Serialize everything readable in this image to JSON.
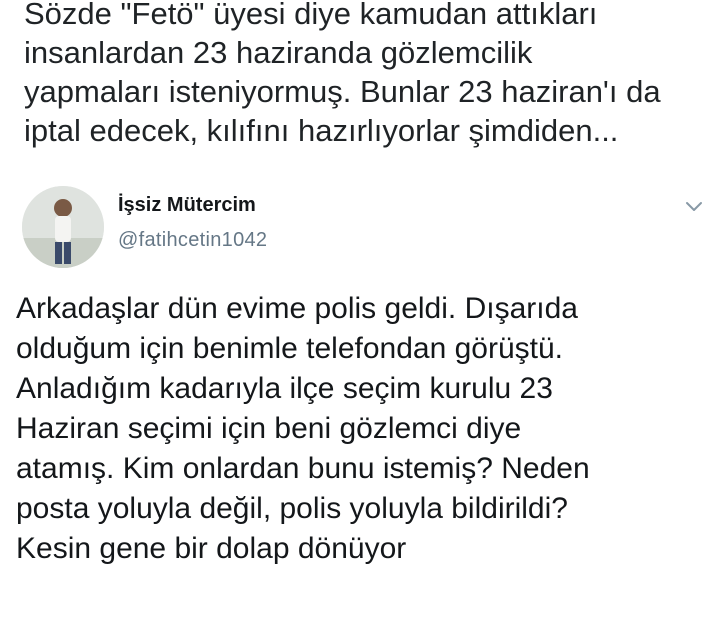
{
  "quote": {
    "text": "Sözde \"Fetö\" üyesi diye kamudan attıkları\ninsanlardan 23 haziranda gözlemcilik\nyapmaları isteniyormuş. Bunlar 23 haziran'ı da\niptal edecek, kılıfını hazırlıyorlar şimdiden..."
  },
  "tweet": {
    "author_name": "İşsiz Mütercim",
    "author_handle": "@fatihcetin1042",
    "menu_icon": "chevron-down-icon",
    "avatar_icon": "profile-photo",
    "text": "Arkadaşlar dün evime polis geldi. Dışarıda\nolduğum için benimle telefondan görüştü.\nAnladığım kadarıyla ilçe seçim kurulu 23\nHaziran seçimi için beni gözlemci diye\natamış. Kim onlardan bunu istemiş? Neden\nposta yoluyla değil, polis yoluyla bildirildi?\nKesin gene bir dolap dönüyor"
  },
  "colors": {
    "text": "#14171a",
    "handle": "#657786",
    "chevron": "#8899a6"
  }
}
